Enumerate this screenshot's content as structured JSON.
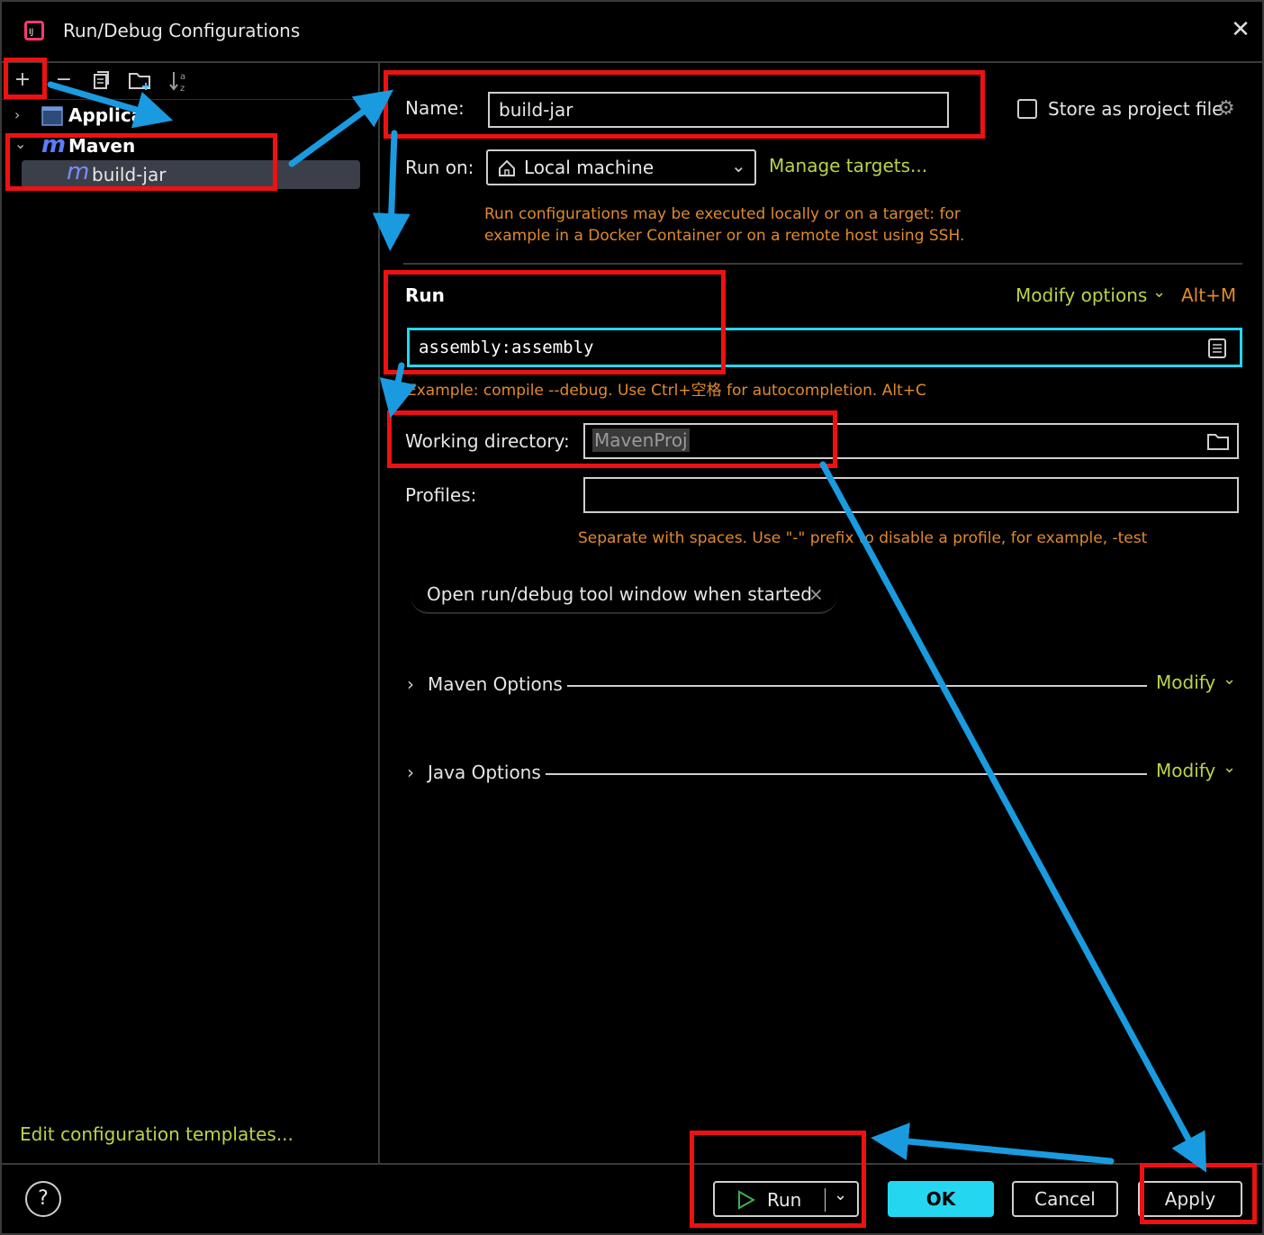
{
  "window": {
    "title": "Run/Debug Configurations",
    "close_label": "✕"
  },
  "toolbar": {
    "icons": [
      "add-icon",
      "remove-icon",
      "copy-icon",
      "new-folder-icon",
      "sort-alpha-icon"
    ]
  },
  "tree": {
    "application_label": "Applica",
    "maven_label": "Maven",
    "selected_item_label": "build-jar",
    "maven_glyph": "m"
  },
  "left_footer": {
    "edit_templates_link": "Edit configuration templates..."
  },
  "config": {
    "name_label": "Name:",
    "name_value": "build-jar",
    "store_label": "Store as project file",
    "run_on_label": "Run on:",
    "run_on_value": "Local machine",
    "manage_targets_link": "Manage targets...",
    "run_on_hint_line1": "Run configurations may be executed locally or on a target: for",
    "run_on_hint_line2": "example in a Docker Container or on a remote host using SSH.",
    "run_section_label": "Run",
    "modify_options_link": "Modify options",
    "modify_options_shortcut": "Alt+M",
    "command_value": "assembly:assembly",
    "command_hint": "Example: compile --debug. Use Ctrl+空格 for autocompletion. Alt+C",
    "working_dir_label": "Working directory:",
    "working_dir_value": "MavenProj",
    "profiles_label": "Profiles:",
    "profiles_value": "",
    "profiles_hint": "Separate with spaces. Use \"-\" prefix to disable a profile, for example, -test",
    "chip_label": "Open run/debug tool window when started",
    "maven_options_label": "Maven Options",
    "java_options_label": "Java Options",
    "modify_label": "Modify"
  },
  "footer": {
    "help_label": "?",
    "run_label": "Run",
    "ok_label": "OK",
    "cancel_label": "Cancel",
    "apply_label": "Apply"
  },
  "colors": {
    "annotation_red": "#ee1111",
    "annotation_arrow": "#1a9be0",
    "accent_cyan": "#25d6f0",
    "link_green": "#b8d44a",
    "hint_orange": "#e08a2c"
  }
}
